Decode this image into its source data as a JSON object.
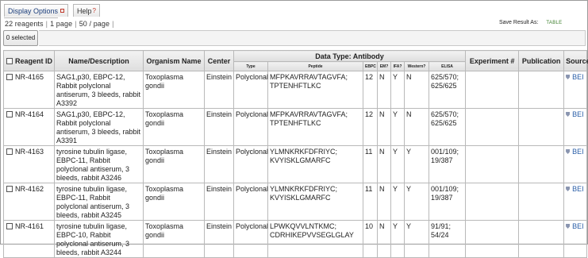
{
  "toolbar": {
    "display_options": "Display Options",
    "help": "Help",
    "help_mark": "?"
  },
  "paging": {
    "reagents": "22 reagents",
    "pages": "1 page",
    "per_page": "50 / page",
    "trailing": "|"
  },
  "save": {
    "label": "Save Result As:",
    "table_btn": "TABLE"
  },
  "selection": {
    "label": "0 selected"
  },
  "table": {
    "headers": {
      "reagent_id": "Reagent ID",
      "name": "Name/Description",
      "organism": "Organism Name",
      "center": "Center",
      "data_type": "Data Type: Antibody",
      "type": "Type",
      "peptide": "Peptide",
      "ebpc": "EBPC",
      "em": "EM?",
      "ifa": "IFA?",
      "western": "Western?",
      "elisa": "ELISA",
      "experiment": "Experiment #",
      "publication": "Publication",
      "source": "Source"
    },
    "rows": [
      {
        "id": "NR-4165",
        "name": "SAG1,p30, EBPC-12, Rabbit polyclonal antiserum, 3 bleeds, rabbit A3392",
        "organism": "Toxoplasma gondii",
        "center": "Einstein",
        "type": "Polyclonal",
        "peptide": "MFPKAVRRAVTAGVFA; TPTENHFTLKC",
        "ebpc": "12",
        "em": "N",
        "ifa": "Y",
        "western": "N",
        "elisa": "625/570; 625/625",
        "experiment": "",
        "publication": "",
        "source": "BEI"
      },
      {
        "id": "NR-4164",
        "name": "SAG1,p30, EBPC-12, Rabbit polyclonal antiserum, 3 bleeds, rabbit A3391",
        "organism": "Toxoplasma gondii",
        "center": "Einstein",
        "type": "Polyclonal",
        "peptide": "MFPKAVRRAVTAGVFA; TPTENHFTLKC",
        "ebpc": "12",
        "em": "N",
        "ifa": "Y",
        "western": "N",
        "elisa": "625/570; 625/625",
        "experiment": "",
        "publication": "",
        "source": "BEI"
      },
      {
        "id": "NR-4163",
        "name": "tyrosine tubulin ligase, EBPC-11, Rabbit polyclonal antiserum, 3 bleeds, rabbit A3246",
        "organism": "Toxoplasma gondii",
        "center": "Einstein",
        "type": "Polyclonal",
        "peptide": "YLMNKRKFDFRIYC; KVYISKLGMARFC",
        "ebpc": "11",
        "em": "N",
        "ifa": "Y",
        "western": "Y",
        "elisa": "001/109; 19/387",
        "experiment": "",
        "publication": "",
        "source": "BEI"
      },
      {
        "id": "NR-4162",
        "name": "tyrosine tubulin ligase, EBPC-11, Rabbit polyclonal antiserum, 3 bleeds, rabbit A3245",
        "organism": "Toxoplasma gondii",
        "center": "Einstein",
        "type": "Polyclonal",
        "peptide": "YLMNKRKFDFRIYC; KVYISKLGMARFC",
        "ebpc": "11",
        "em": "N",
        "ifa": "Y",
        "western": "Y",
        "elisa": "001/109; 19/387",
        "experiment": "",
        "publication": "",
        "source": "BEI"
      },
      {
        "id": "NR-4161",
        "name": "tyrosine tubulin ligase, EBPC-10, Rabbit polyclonal antiserum, 3 bleeds, rabbit A3244",
        "organism": "Toxoplasma gondii",
        "center": "Einstein",
        "type": "Polyclonal",
        "peptide": "LPWKQVVLNTKMC; CDRHIKEPVVSEGLGLAY",
        "ebpc": "10",
        "em": "N",
        "ifa": "Y",
        "western": "Y",
        "elisa": "91/91; 54/24",
        "experiment": "",
        "publication": "",
        "source": "BEI"
      }
    ]
  }
}
